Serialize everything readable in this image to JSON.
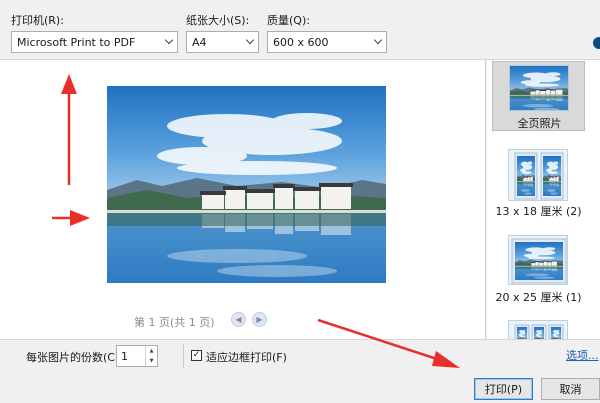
{
  "printer": {
    "label": "打印机(R):",
    "value": "Microsoft Print to PDF"
  },
  "paper_size": {
    "label": "纸张大小(S):",
    "value": "A4"
  },
  "quality": {
    "label": "质量(Q):",
    "value": "600 x 600"
  },
  "preview": {
    "page_indicator": "第 1 页(共 1 页)"
  },
  "layouts": [
    {
      "label": "全页照片",
      "selected": true
    },
    {
      "label": "13 x 18 厘米 (2)",
      "selected": false
    },
    {
      "label": "20 x 25 厘米 (1)",
      "selected": false
    }
  ],
  "copies": {
    "label": "每张图片的份数(C):",
    "value": "1"
  },
  "fit_frame": {
    "label": "适应边框打印(F)",
    "checked": true
  },
  "options_link": "选项...",
  "buttons": {
    "print": "打印(P)",
    "cancel": "取消"
  },
  "colors": {
    "annotation_arrow": "#e8302a",
    "link": "#1b5fb0",
    "primary_border": "#2a7ad0"
  }
}
